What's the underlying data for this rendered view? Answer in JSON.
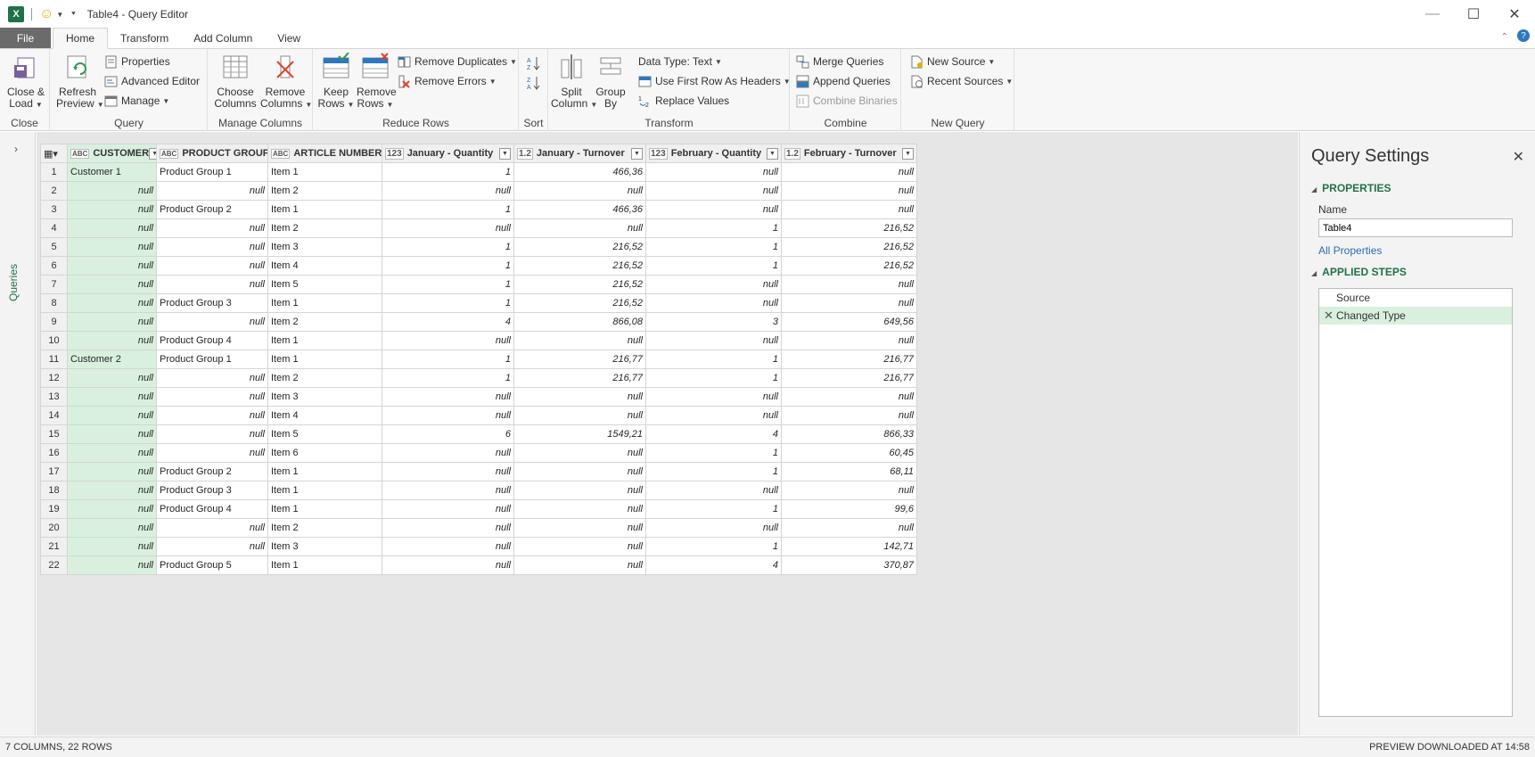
{
  "window": {
    "title": "Table4 - Query Editor",
    "app_icon": "X",
    "smiley": "☺",
    "minimize": "—",
    "maximize": "☐",
    "close": "✕"
  },
  "tabs": [
    {
      "label": "File"
    },
    {
      "label": "Home"
    },
    {
      "label": "Transform"
    },
    {
      "label": "Add Column"
    },
    {
      "label": "View"
    }
  ],
  "ribbon": {
    "close_group": {
      "label": "Close",
      "close_load": "Close &",
      "close_load2": "Load"
    },
    "query_group": {
      "label": "Query",
      "refresh": "Refresh",
      "refresh2": "Preview",
      "properties": "Properties",
      "advanced": "Advanced Editor",
      "manage": "Manage"
    },
    "manage_cols_group": {
      "label": "Manage Columns",
      "choose": "Choose",
      "choose2": "Columns",
      "remove": "Remove",
      "remove2": "Columns"
    },
    "reduce_rows_group": {
      "label": "Reduce Rows",
      "keep": "Keep",
      "keep2": "Rows",
      "remove": "Remove",
      "remove2": "Rows",
      "remove_dup": "Remove Duplicates",
      "remove_err": "Remove Errors"
    },
    "sort_group": {
      "label": "Sort"
    },
    "transform_group": {
      "label": "Transform",
      "split": "Split",
      "split2": "Column",
      "group": "Group",
      "group2": "By",
      "datatype": "Data Type: Text",
      "first_row": "Use First Row As Headers",
      "replace": "Replace Values"
    },
    "combine_group": {
      "label": "Combine",
      "merge": "Merge Queries",
      "append": "Append Queries",
      "combine_bin": "Combine Binaries"
    },
    "newquery_group": {
      "label": "New Query",
      "new_source": "New Source",
      "recent": "Recent Sources"
    }
  },
  "queries_pane": {
    "label": "Queries"
  },
  "table": {
    "columns": [
      {
        "type": "ABC",
        "name": "CUSTOMER"
      },
      {
        "type": "ABC",
        "name": "PRODUCT GROUP"
      },
      {
        "type": "ABC",
        "name": "ARTICLE NUMBER"
      },
      {
        "type": "123",
        "name": "January - Quantity"
      },
      {
        "type": "1.2",
        "name": "January - Turnover"
      },
      {
        "type": "123",
        "name": "February - Quantity"
      },
      {
        "type": "1.2",
        "name": "February - Turnover"
      }
    ],
    "rows": [
      [
        "1",
        "Customer 1",
        "Product Group 1",
        "Item 1",
        "1",
        "466,36",
        "null",
        "null"
      ],
      [
        "2",
        "null",
        "null",
        "Item 2",
        "null",
        "null",
        "null",
        "null"
      ],
      [
        "3",
        "null",
        "Product Group 2",
        "Item 1",
        "1",
        "466,36",
        "null",
        "null"
      ],
      [
        "4",
        "null",
        "null",
        "Item 2",
        "null",
        "null",
        "1",
        "216,52"
      ],
      [
        "5",
        "null",
        "null",
        "Item 3",
        "1",
        "216,52",
        "1",
        "216,52"
      ],
      [
        "6",
        "null",
        "null",
        "Item 4",
        "1",
        "216,52",
        "1",
        "216,52"
      ],
      [
        "7",
        "null",
        "null",
        "Item 5",
        "1",
        "216,52",
        "null",
        "null"
      ],
      [
        "8",
        "null",
        "Product Group 3",
        "Item 1",
        "1",
        "216,52",
        "null",
        "null"
      ],
      [
        "9",
        "null",
        "null",
        "Item 2",
        "4",
        "866,08",
        "3",
        "649,56"
      ],
      [
        "10",
        "null",
        "Product Group 4",
        "Item 1",
        "null",
        "null",
        "null",
        "null"
      ],
      [
        "11",
        "Customer 2",
        "Product Group 1",
        "Item 1",
        "1",
        "216,77",
        "1",
        "216,77"
      ],
      [
        "12",
        "null",
        "null",
        "Item 2",
        "1",
        "216,77",
        "1",
        "216,77"
      ],
      [
        "13",
        "null",
        "null",
        "Item 3",
        "null",
        "null",
        "null",
        "null"
      ],
      [
        "14",
        "null",
        "null",
        "Item 4",
        "null",
        "null",
        "null",
        "null"
      ],
      [
        "15",
        "null",
        "null",
        "Item 5",
        "6",
        "1549,21",
        "4",
        "866,33"
      ],
      [
        "16",
        "null",
        "null",
        "Item 6",
        "null",
        "null",
        "1",
        "60,45"
      ],
      [
        "17",
        "null",
        "Product Group 2",
        "Item 1",
        "null",
        "null",
        "1",
        "68,11"
      ],
      [
        "18",
        "null",
        "Product Group 3",
        "Item 1",
        "null",
        "null",
        "null",
        "null"
      ],
      [
        "19",
        "null",
        "Product Group 4",
        "Item 1",
        "null",
        "null",
        "1",
        "99,6"
      ],
      [
        "20",
        "null",
        "null",
        "Item 2",
        "null",
        "null",
        "null",
        "null"
      ],
      [
        "21",
        "null",
        "null",
        "Item 3",
        "null",
        "null",
        "1",
        "142,71"
      ],
      [
        "22",
        "null",
        "Product Group 5",
        "Item 1",
        "null",
        "null",
        "4",
        "370,87"
      ]
    ]
  },
  "settings": {
    "title": "Query Settings",
    "properties_head": "PROPERTIES",
    "name_label": "Name",
    "name_value": "Table4",
    "all_properties": "All Properties",
    "steps_head": "APPLIED STEPS",
    "steps": [
      {
        "label": "Source",
        "active": false
      },
      {
        "label": "Changed Type",
        "active": true
      }
    ]
  },
  "status": {
    "left": "7 COLUMNS, 22 ROWS",
    "right": "PREVIEW DOWNLOADED AT 14:58"
  },
  "colors": {
    "accent": "#217346",
    "selection": "#d9f0df"
  }
}
